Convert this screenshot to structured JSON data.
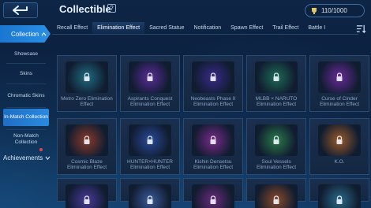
{
  "header": {
    "title": "Collectible",
    "help": "?",
    "counter": "110/1000"
  },
  "tabs": [
    {
      "label": "Recall Effect",
      "active": false
    },
    {
      "label": "Elimination Effect",
      "active": true
    },
    {
      "label": "Sacred Statue",
      "active": false
    },
    {
      "label": "Notification",
      "active": false
    },
    {
      "label": "Spawn Effect",
      "active": false
    },
    {
      "label": "Trail Effect",
      "active": false
    },
    {
      "label": "Battle I",
      "active": false
    }
  ],
  "sidebar": {
    "main": "Collection",
    "items": [
      {
        "label": "Showcase"
      },
      {
        "label": "Skins"
      },
      {
        "label": "Chromatic Skins"
      },
      {
        "label": "In-Match Collection",
        "active": true
      },
      {
        "label": "Non-Match Collection"
      }
    ],
    "achievements": "Achievements"
  },
  "cards": [
    {
      "label": "Metro Zero Elimination Effect",
      "color": "#1f6a80"
    },
    {
      "label": "Aspirants Conquest Elimination Effect",
      "color": "#5a2c9a"
    },
    {
      "label": "Neobeasts Phase II Elimination Effect",
      "color": "#3a2a8a"
    },
    {
      "label": "MLBB × NARUTO Elimination Effect",
      "color": "#1e6a55"
    },
    {
      "label": "Curse of Cinder Elimination Effect",
      "color": "#6a2a9a"
    },
    {
      "label": "Cosmic Blaze Elimination Effect",
      "color": "#8a3a2a"
    },
    {
      "label": "HUNTER×HUNTER Elimination Effect",
      "color": "#2a4a9a"
    },
    {
      "label": "Kishin Densetsu Elimination Effect",
      "color": "#7a2a8a"
    },
    {
      "label": "Soul Vessels Elimination Effect",
      "color": "#2a7a4a"
    },
    {
      "label": "K.O.",
      "color": "#9a5a2a"
    },
    {
      "label": "",
      "color": "#4a3a9a"
    },
    {
      "label": "",
      "color": "#3a5a9a"
    },
    {
      "label": "",
      "color": "#6a2a7a"
    },
    {
      "label": "",
      "color": "#8a4a2a"
    },
    {
      "label": "",
      "color": "#2a6a8a"
    }
  ]
}
